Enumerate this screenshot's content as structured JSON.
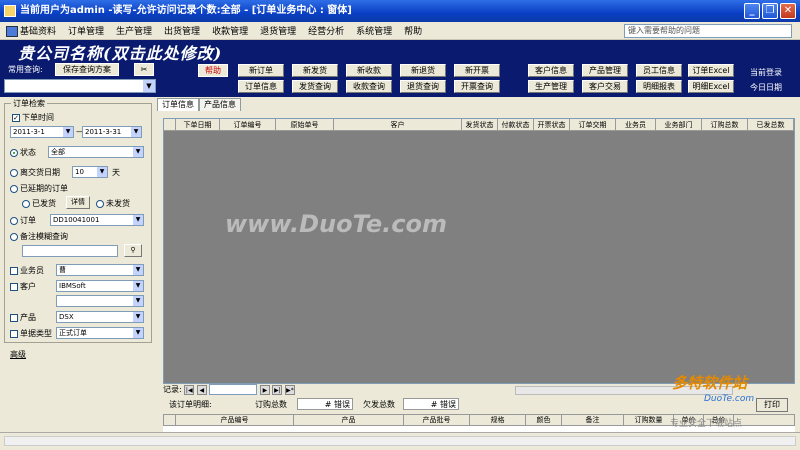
{
  "window": {
    "title": "当前用户为admin -读写-允许访问记录个数:全部 - [订单业务中心 : 窗体]"
  },
  "menu": [
    "基础资料",
    "订单管理",
    "生产管理",
    "出货管理",
    "收款管理",
    "退货管理",
    "经营分析",
    "系统管理",
    "帮助"
  ],
  "help_placeholder": "键入需要帮助的问题",
  "header": {
    "company": "贵公司名称(双击此处修改)",
    "query_label": "常用查询:",
    "save_query": "保存查询方案",
    "help": "帮助",
    "row1": [
      "新订单",
      "新发货",
      "新收款",
      "新退货",
      "新开票",
      "客户信息",
      "产品管理",
      "员工信息",
      "订单Excel"
    ],
    "row2": [
      "订单信息",
      "发货查询",
      "收款查询",
      "退货查询",
      "开票查询",
      "生产管理",
      "客户交易",
      "明细报表",
      "明细Excel"
    ],
    "login1": "当前登录",
    "login2": "今日日期"
  },
  "filter": {
    "group_title": "订单检索",
    "order_time": "下单时间",
    "date_from": "2011-3-1",
    "date_to": "2011-3-31",
    "status_label": "状态",
    "status_value": "全部",
    "delivery_label": "离交货日期",
    "delivery_days": "10",
    "days_unit": "天",
    "overdue_label": "已延期的订单",
    "shipped": "已发货",
    "detail": "详情",
    "not_shipped": "未发货",
    "order_label": "订单",
    "order_value": "DD10041001",
    "remark_label": "备注模糊查询",
    "salesman_label": "业务员",
    "salesman_value": "曹",
    "customer_label": "客户",
    "customer_value": "IBMSoft",
    "product_label": "产品",
    "product_value": "DSX",
    "doc_type_label": "单据类型",
    "doc_type_value": "正式订单",
    "advanced": "高级"
  },
  "tabs": [
    "订单信息",
    "产品信息"
  ],
  "grid_columns": [
    "下单日期",
    "订单编号",
    "原始单号",
    "客户",
    "发货状态",
    "付款状态",
    "开票状态",
    "订单交期",
    "业务员",
    "业务部门",
    "订购总数",
    "已发总数"
  ],
  "watermark": "www.DuoTe.com",
  "records_label": "记录:",
  "summary": {
    "label": "该订单明细:",
    "total_qty": "订购总数",
    "total_val": "# 错误",
    "owed_label": "欠发总数",
    "owed_val": "# 错误",
    "print": "打印"
  },
  "detail_columns": [
    "产品编号",
    "产品",
    "产品批号",
    "规格",
    "颜色",
    "备注",
    "订购数量",
    "单价",
    "总价"
  ],
  "logo": {
    "line1": "多特软件站",
    "line2": "DuoTe.com",
    "line3": "专业安全下载站点"
  }
}
